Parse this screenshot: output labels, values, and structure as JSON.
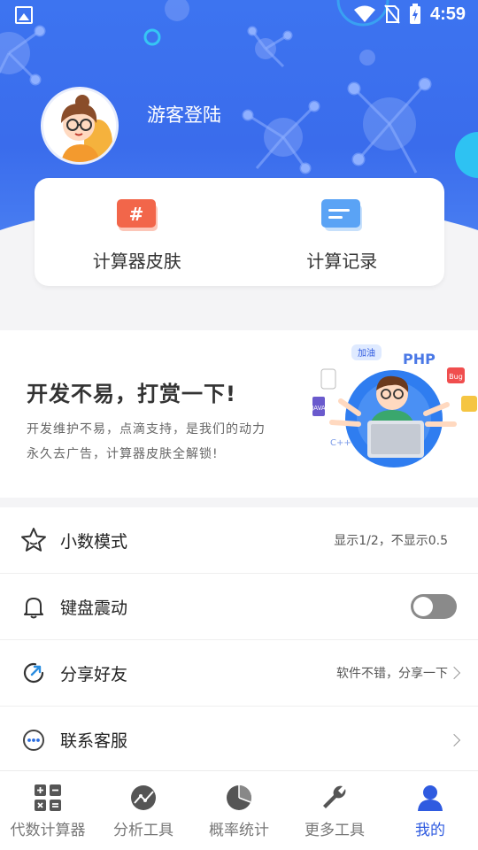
{
  "status_bar": {
    "time": "4:59",
    "icons": [
      "image-icon",
      "wifi-icon",
      "no-sim-icon",
      "battery-charging-icon"
    ]
  },
  "profile": {
    "login_text": "游客登陆"
  },
  "quick_actions": [
    {
      "label": "计算器皮肤",
      "icon": "hash-skin-icon",
      "color": "#f2664a"
    },
    {
      "label": "计算记录",
      "icon": "record-list-icon",
      "color": "#5aa3f5"
    }
  ],
  "banner": {
    "title": "开发不易，打赏一下!",
    "subtitle_line1": "开发维护不易，点滴支持，是我们的动力",
    "subtitle_line2": "永久去广告，计算器皮肤全解锁!",
    "illustration_labels": [
      "加油",
      "PHP",
      "Bug",
      "C++",
      "JAVA"
    ]
  },
  "settings": [
    {
      "label": "小数模式",
      "icon": "star-icon",
      "value": "显示1/2，不显示0.5"
    },
    {
      "label": "键盘震动",
      "icon": "bell-icon",
      "toggle": false
    },
    {
      "label": "分享好友",
      "icon": "share-icon",
      "value": "软件不错，分享一下"
    },
    {
      "label": "联系客服",
      "icon": "chat-icon",
      "value": ""
    }
  ],
  "tabs": [
    {
      "label": "代数计算器",
      "icon": "calculator-icon",
      "active": false
    },
    {
      "label": "分析工具",
      "icon": "analysis-icon",
      "active": false
    },
    {
      "label": "概率统计",
      "icon": "pie-chart-icon",
      "active": false
    },
    {
      "label": "更多工具",
      "icon": "wrench-icon",
      "active": false
    },
    {
      "label": "我的",
      "icon": "user-icon",
      "active": true
    }
  ],
  "colors": {
    "primary": "#3a6cec",
    "active_tab": "#2f5be0",
    "toggle_off": "#8a8a8a"
  }
}
